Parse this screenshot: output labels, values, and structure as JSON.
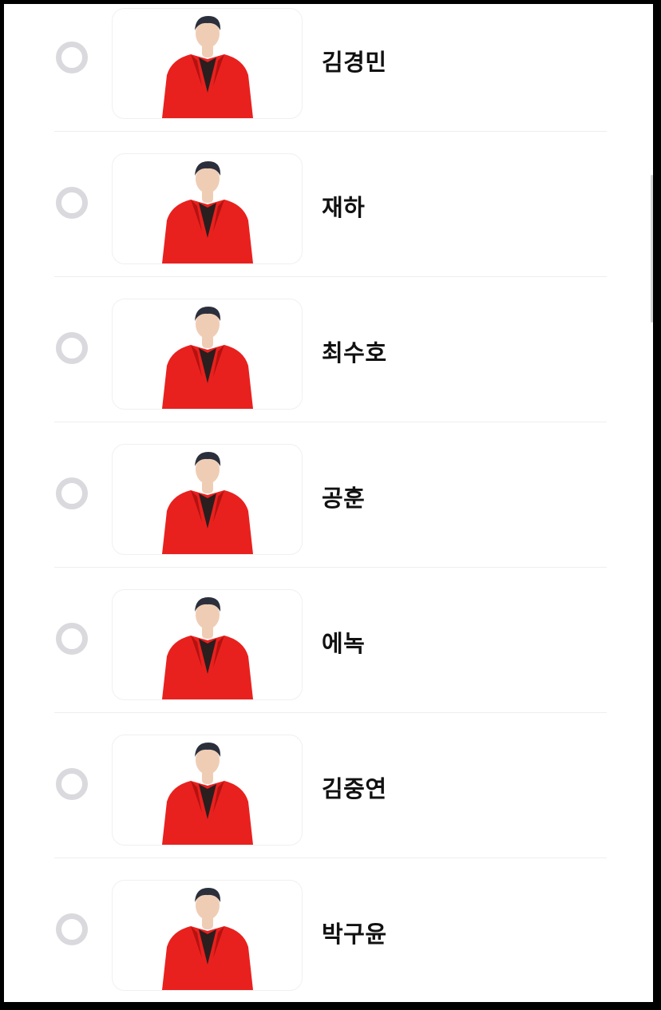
{
  "colors": {
    "outfit": "#e8211f",
    "outfit_shade": "#b5120f",
    "shirt": "#2a1e1e",
    "skin": "#efcdb4",
    "hair": "#2b2f3c",
    "radio_ring": "#d9d9de"
  },
  "candidates": [
    {
      "name": "김경민"
    },
    {
      "name": "재하"
    },
    {
      "name": "최수호"
    },
    {
      "name": "공훈"
    },
    {
      "name": "에녹"
    },
    {
      "name": "김중연"
    },
    {
      "name": "박구윤"
    }
  ]
}
